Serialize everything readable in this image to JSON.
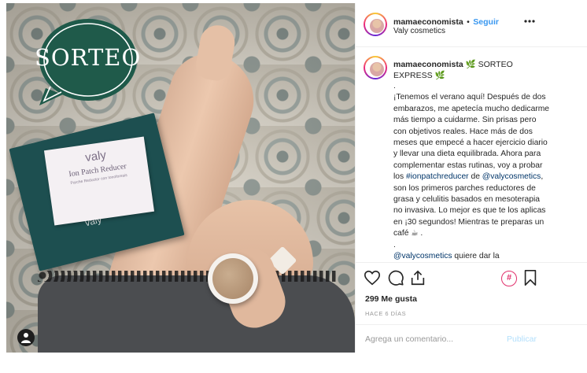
{
  "photo": {
    "sticker_text": "SORTEO",
    "product_brand": "valy",
    "product_title": "Ion Patch Reducer",
    "product_subtitle": "Parche Reductor con Ionoforesis",
    "box_brand": "valy"
  },
  "header": {
    "username": "mamaeconomista",
    "separator": "•",
    "follow_label": "Seguir",
    "location": "Valy cosmetics",
    "more_icon": "more-horizontal-icon"
  },
  "caption": {
    "username": "mamaeconomista",
    "title_rest": "🌿 SORTEO EXPRESS 🌿",
    "dot": ".",
    "text_1": "¡Tenemos el verano aquí! Después de dos embarazos, me apetecía mucho dedicarme más tiempo a cuidarme. Sin prisas pero con objetivos reales. Hace más de dos meses que empecé a hacer ejercicio diario y llevar una dieta equilibrada. Ahora para complementar estas rutinas, voy a probar los ",
    "link_1": "#ionpatchreducer",
    "text_2": " de ",
    "link_2": "@valycosmetics",
    "text_3": ", son los primeros parches reductores de grasa y celulitis basados en mesoterapia no invasiva. Lo mejor es que te los aplicas en ¡30 segundos! Mientras te preparas un café ☕ .",
    "dot_2": ".",
    "link_3": "@valycosmetics",
    "text_4": " quiere dar la"
  },
  "actions": {
    "like_icon": "heart-icon",
    "comment_icon": "comment-icon",
    "share_icon": "share-icon",
    "hashtag_icon": "hashtag-icon",
    "hashtag_label": "#",
    "save_icon": "bookmark-icon",
    "likes": "299 Me gusta",
    "time": "HACE 6 DÍAS",
    "comment_placeholder": "Agrega un comentario...",
    "publish_label": "Publicar"
  },
  "colors": {
    "link_blue": "#3897f0",
    "publish_disabled": "#b2dffc",
    "sticker_green": "#1f5a4a",
    "hashtag_pink": "#e1306c"
  }
}
